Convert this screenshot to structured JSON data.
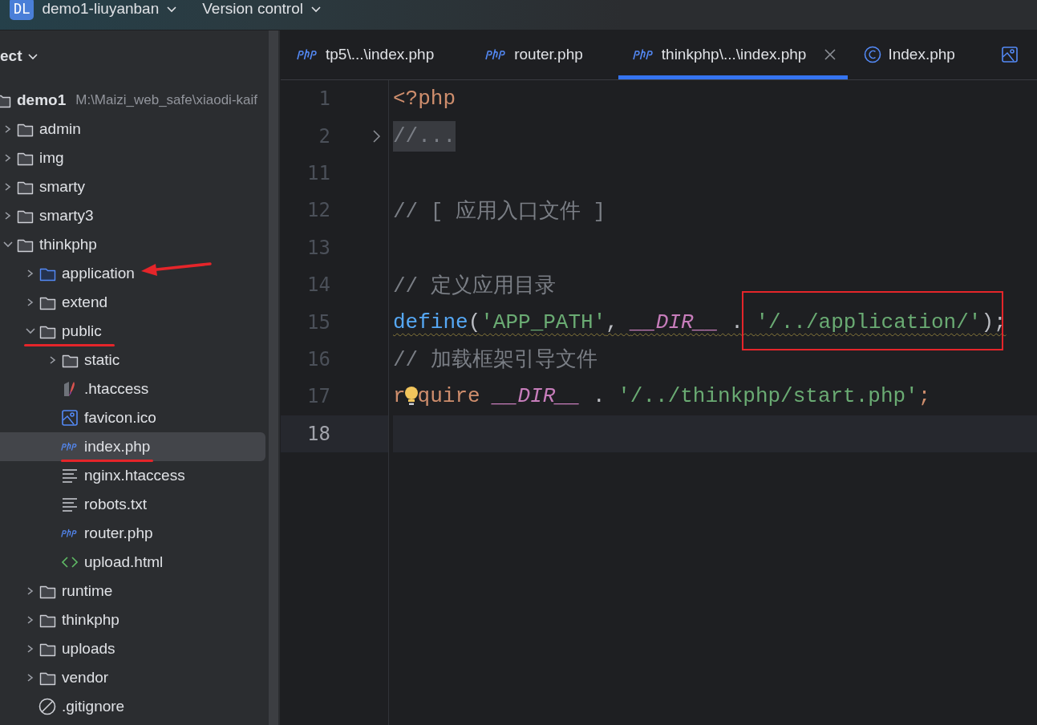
{
  "top_bar": {
    "project_badge": "DL",
    "project": "demo1-liuyanban",
    "vcs": "Version control"
  },
  "project_panel": {
    "title": "ect",
    "tree": [
      {
        "label": "demo1",
        "hint": "M:\\Maizi_web_safe\\xiaodi-kaif",
        "kind": "folder",
        "selected": false,
        "children": [
          {
            "label": "admin",
            "kind": "folder",
            "expanded": false,
            "selected": false
          },
          {
            "label": "img",
            "kind": "folder",
            "expanded": false,
            "selected": false
          },
          {
            "label": "smarty",
            "kind": "folder",
            "expanded": false,
            "selected": false
          },
          {
            "label": "smarty3",
            "kind": "folder",
            "expanded": false,
            "selected": false
          },
          {
            "label": "thinkphp",
            "kind": "folder",
            "expanded": true,
            "selected": false,
            "children": [
              {
                "label": "application",
                "kind": "source_folder",
                "expanded": false,
                "selected": false,
                "arrow_mark": true
              },
              {
                "label": "extend",
                "kind": "folder",
                "expanded": false,
                "selected": false
              },
              {
                "label": "public",
                "kind": "folder",
                "expanded": true,
                "selected": false,
                "underline_mark": true,
                "children": [
                  {
                    "label": "static",
                    "kind": "folder",
                    "expanded": false,
                    "selected": false
                  },
                  {
                    "label": ".htaccess",
                    "kind": "apache",
                    "selected": false
                  },
                  {
                    "label": "favicon.ico",
                    "kind": "image",
                    "selected": false
                  },
                  {
                    "label": "index.php",
                    "kind": "php",
                    "selected": true,
                    "underline_mark": true
                  },
                  {
                    "label": "nginx.htaccess",
                    "kind": "text",
                    "selected": false
                  },
                  {
                    "label": "robots.txt",
                    "kind": "text",
                    "selected": false
                  },
                  {
                    "label": "router.php",
                    "kind": "php",
                    "selected": false
                  },
                  {
                    "label": "upload.html",
                    "kind": "html",
                    "selected": false
                  }
                ]
              },
              {
                "label": "runtime",
                "kind": "folder",
                "expanded": false,
                "selected": false
              },
              {
                "label": "thinkphp",
                "kind": "folder",
                "expanded": false,
                "selected": false
              },
              {
                "label": "uploads",
                "kind": "folder",
                "expanded": false,
                "selected": false
              },
              {
                "label": "vendor",
                "kind": "folder",
                "expanded": false,
                "selected": false
              },
              {
                "label": ".gitignore",
                "kind": "ignore",
                "selected": false
              }
            ]
          }
        ]
      }
    ]
  },
  "editor": {
    "tabs": [
      {
        "label": "tp5\\...\\index.php",
        "kind": "php",
        "selected": false
      },
      {
        "label": "router.php",
        "kind": "php",
        "selected": false
      },
      {
        "label": "thinkphp\\...\\index.php",
        "kind": "php",
        "selected": true
      },
      {
        "label": "Index.php",
        "kind": "class",
        "selected": false
      },
      {
        "kind": "image",
        "selected": false
      }
    ],
    "lines": [
      {
        "number": "1",
        "tokens": [
          {
            "text": "<?php",
            "kind": "keyword"
          }
        ]
      },
      {
        "number": "2",
        "folded": true,
        "tokens": [
          {
            "text": "//...",
            "kind": "folded"
          }
        ]
      },
      {
        "number": "11"
      },
      {
        "number": "12",
        "tokens": [
          {
            "text": "// [ 应用入口文件 ]",
            "kind": "comment"
          }
        ]
      },
      {
        "number": "13"
      },
      {
        "number": "14",
        "tokens": [
          {
            "text": "// 定义应用目录",
            "kind": "comment"
          }
        ]
      },
      {
        "number": "15",
        "warning": true,
        "tokens": [
          {
            "text": "define",
            "kind": "function"
          },
          {
            "text": "(",
            "kind": "plain"
          },
          {
            "text": "'APP_PATH'",
            "kind": "string"
          },
          {
            "text": ", ",
            "kind": "plain"
          },
          {
            "text": "__DIR__",
            "kind": "constant"
          },
          {
            "text": " . ",
            "kind": "plain"
          },
          {
            "text": "'/../application/'",
            "kind": "string",
            "boxed": true
          },
          {
            "text": ");",
            "kind": "plain"
          }
        ]
      },
      {
        "number": "16",
        "tokens": [
          {
            "text": "// 加载框架引导文件",
            "kind": "comment"
          }
        ]
      },
      {
        "number": "17",
        "tokens": [
          {
            "text": "r",
            "kind": "keyword"
          },
          {
            "kind": "bulb"
          },
          {
            "text": "quire",
            "kind": "keyword"
          },
          {
            "text": "__DIR__",
            "kind": "constant",
            "space_before": true
          },
          {
            "text": " . ",
            "kind": "plain"
          },
          {
            "text": "'/../thinkphp/start.php'",
            "kind": "string"
          },
          {
            "text": ";",
            "kind": "keyword"
          }
        ]
      },
      {
        "number": "18",
        "current": true
      }
    ]
  }
}
